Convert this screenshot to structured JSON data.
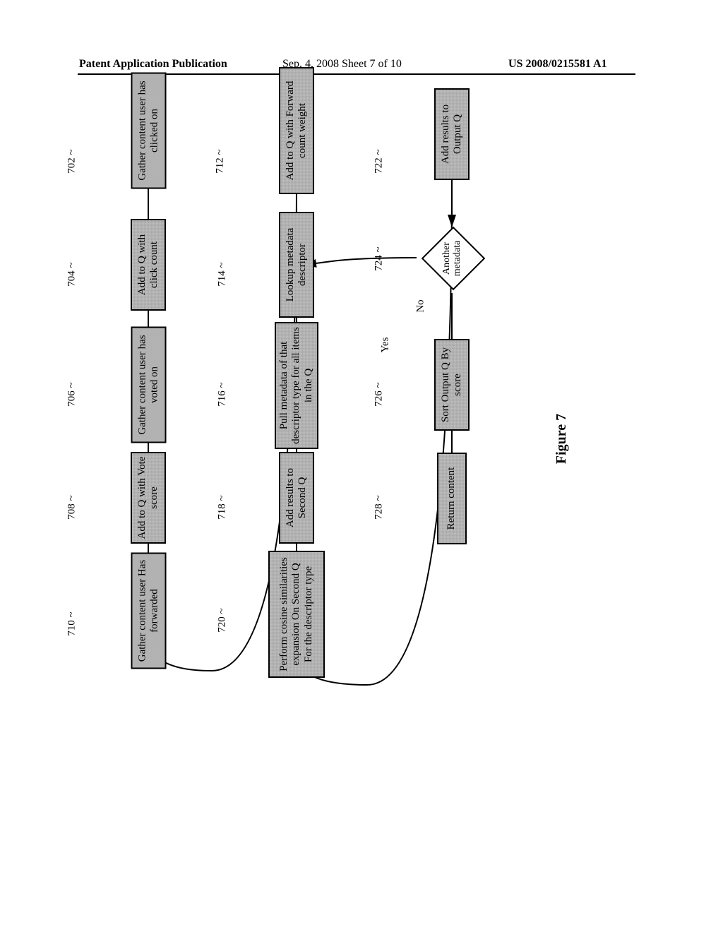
{
  "header": {
    "left": "Patent Application Publication",
    "mid": "Sep. 4, 2008  Sheet 7 of 10",
    "right": "US 2008/0215581 A1"
  },
  "figure_caption": "Figure 7",
  "labels": {
    "yes": "Yes",
    "no": "No"
  },
  "refs": {
    "r702": "702 ~",
    "r704": "704 ~",
    "r706": "706 ~",
    "r708": "708 ~",
    "r710": "710 ~",
    "r712": "712 ~",
    "r714": "714 ~",
    "r716": "716 ~",
    "r718": "718 ~",
    "r720": "720 ~",
    "r722": "722 ~",
    "r724": "724 ~",
    "r726": "726 ~",
    "r728": "728 ~"
  },
  "boxes": {
    "b702": "Gather content user has clicked on",
    "b704": "Add to Q with click count",
    "b706": "Gather content user has voted on",
    "b708": "Add to Q with Vote score",
    "b710": "Gather content user Has forwarded",
    "b712": "Add to Q with Forward count weight",
    "b714": "Lookup metadata descriptor",
    "b716": "Pull metadata of that descriptor type for all items in the Q",
    "b718": "Add results to Second Q",
    "b720": "Perform cosine similarities expansion On Second Q For the descriptor type",
    "b722": "Add results to Output Q",
    "b724": "Another metadata",
    "b726": "Sort Output Q By score",
    "b728": "Return content"
  },
  "chart_data": {
    "type": "flowchart",
    "title": "Figure 7",
    "nodes": [
      {
        "id": "702",
        "type": "process",
        "text": "Gather content user has clicked on"
      },
      {
        "id": "704",
        "type": "process",
        "text": "Add to Q with click count"
      },
      {
        "id": "706",
        "type": "process",
        "text": "Gather content user has voted on"
      },
      {
        "id": "708",
        "type": "process",
        "text": "Add to Q with Vote score"
      },
      {
        "id": "710",
        "type": "process",
        "text": "Gather content user Has forwarded"
      },
      {
        "id": "712",
        "type": "process",
        "text": "Add to Q with Forward count weight"
      },
      {
        "id": "714",
        "type": "process",
        "text": "Lookup metadata descriptor"
      },
      {
        "id": "716",
        "type": "process",
        "text": "Pull metadata of that descriptor type for all items in the Q"
      },
      {
        "id": "718",
        "type": "process",
        "text": "Add results to Second Q"
      },
      {
        "id": "720",
        "type": "process",
        "text": "Perform cosine similarities expansion On Second Q For the descriptor type"
      },
      {
        "id": "722",
        "type": "process",
        "text": "Add results to Output Q"
      },
      {
        "id": "724",
        "type": "decision",
        "text": "Another metadata"
      },
      {
        "id": "726",
        "type": "process",
        "text": "Sort Output Q By score"
      },
      {
        "id": "728",
        "type": "process",
        "text": "Return content"
      }
    ],
    "edges": [
      {
        "from": "702",
        "to": "704"
      },
      {
        "from": "704",
        "to": "706"
      },
      {
        "from": "706",
        "to": "708"
      },
      {
        "from": "708",
        "to": "710"
      },
      {
        "from": "710",
        "to": "712"
      },
      {
        "from": "712",
        "to": "714"
      },
      {
        "from": "714",
        "to": "716"
      },
      {
        "from": "716",
        "to": "718"
      },
      {
        "from": "718",
        "to": "720"
      },
      {
        "from": "720",
        "to": "722"
      },
      {
        "from": "722",
        "to": "724"
      },
      {
        "from": "724",
        "to": "714",
        "label": "Yes"
      },
      {
        "from": "724",
        "to": "726",
        "label": "No"
      },
      {
        "from": "726",
        "to": "728"
      }
    ]
  }
}
